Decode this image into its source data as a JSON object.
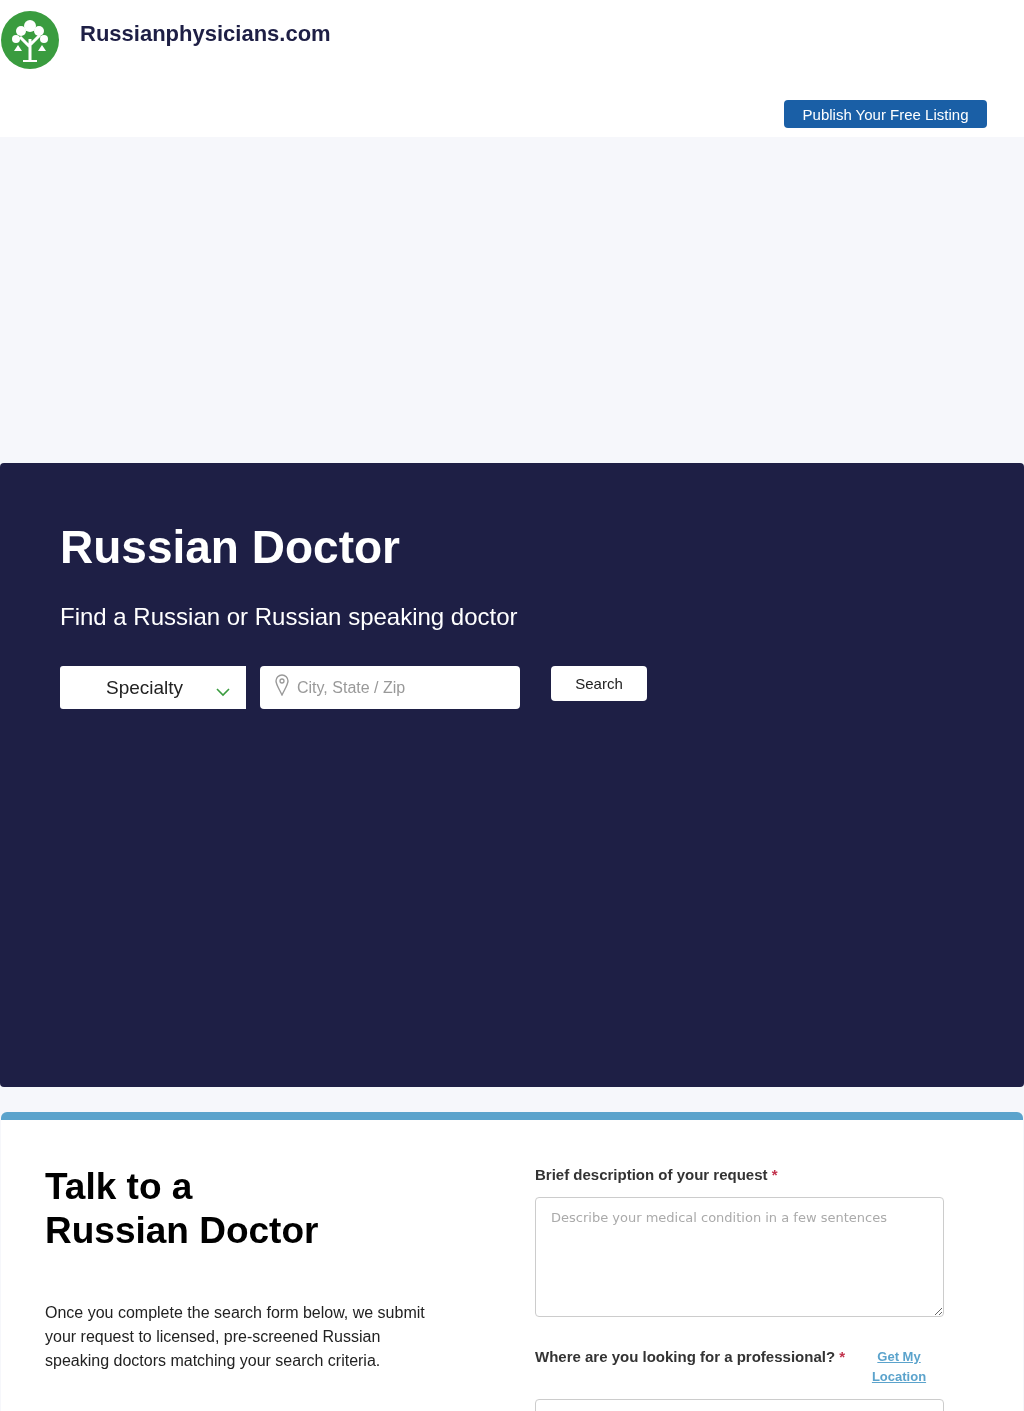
{
  "header": {
    "site_name": "Russianphysicians.com",
    "publish_button": "Publish Your Free Listing"
  },
  "hero": {
    "title": "Russian Doctor",
    "subtitle": "Find a Russian or Russian speaking doctor",
    "specialty_select": {
      "value": "Specialty"
    },
    "location_field": {
      "placeholder": "City, State / Zip"
    },
    "search_button": "Search"
  },
  "contact": {
    "title_lines": [
      "Talk to a",
      "Russian Doctor"
    ],
    "intro": "Once you complete the search form below, we submit your request to licensed, pre-screened Russian speaking doctors matching your search criteria.",
    "fields": [
      {
        "kind": "textarea",
        "label": "Brief description of your request",
        "required_mark": "*",
        "placeholder": "Describe your medical condition in a few sentences"
      },
      {
        "kind": "location",
        "label": "Where are you looking for a professional?",
        "required_mark": "*",
        "link": "Get My Location"
      }
    ]
  }
}
